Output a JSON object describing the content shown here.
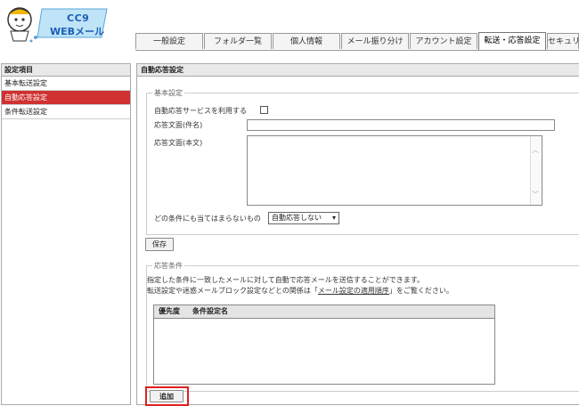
{
  "app": {
    "logo_line1": "CC9",
    "logo_line2": "WEBメール"
  },
  "tabs": [
    {
      "label": "一般設定"
    },
    {
      "label": "フォルダ一覧"
    },
    {
      "label": "個人情報"
    },
    {
      "label": "メール振り分け"
    },
    {
      "label": "アカウント設定"
    },
    {
      "label": "転送・応答設定"
    },
    {
      "label": "セキュリ"
    }
  ],
  "sidebar": {
    "header": "設定項目",
    "items": [
      {
        "label": "基本転送設定"
      },
      {
        "label": "自動応答設定"
      },
      {
        "label": "条件転送設定"
      }
    ]
  },
  "main": {
    "title": "自動応答設定",
    "basic": {
      "legend": "基本設定",
      "use_service_label": "自動応答サービスを利用する",
      "subject_label": "応答文面(件名)",
      "subject_value": "",
      "body_label": "応答文面(本文)",
      "body_value": "",
      "fallback_label": "どの条件にも当てはまらないもの",
      "fallback_value": "自動応答しない"
    },
    "save_label": "保存",
    "conditions": {
      "legend": "応答条件",
      "desc1": "指定した条件に一致したメールに対して自動で応答メールを送信することができます。",
      "desc2_pre": "転送設定や迷惑メールブロック設定などとの関係は「",
      "desc2_link": "メール設定の適用順序",
      "desc2_post": "」をご覧ください。",
      "col_priority": "優先度",
      "col_name": "条件設定名"
    },
    "add_label": "追加"
  },
  "colors": {
    "active_item": "#d03131",
    "highlight": "#e02020"
  }
}
